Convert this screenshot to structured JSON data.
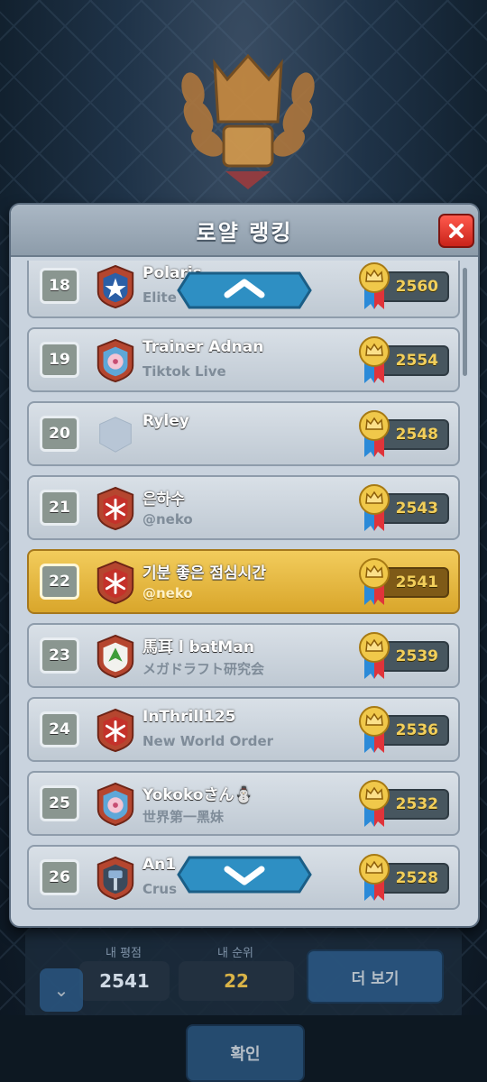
{
  "modal": {
    "title": "로얄 랭킹",
    "close_icon": "close-icon"
  },
  "rows": [
    {
      "rank": "18",
      "name": "Polaris",
      "clan": "Elite",
      "score": "2560",
      "badge": "star"
    },
    {
      "rank": "19",
      "name": "Trainer Adnan",
      "clan": "Tiktok Live",
      "score": "2554",
      "badge": "flower"
    },
    {
      "rank": "20",
      "name": "Ryley",
      "clan": "",
      "score": "2548",
      "badge": "none"
    },
    {
      "rank": "21",
      "name": "은하수",
      "clan": "@neko",
      "score": "2543",
      "badge": "snowflake"
    },
    {
      "rank": "22",
      "name": "기분 좋은 점심시간",
      "clan": "@neko",
      "score": "2541",
      "badge": "snowflake",
      "me": true
    },
    {
      "rank": "23",
      "name": "馬耳 l batMan",
      "clan": "メガドラフト研究会",
      "score": "2539",
      "badge": "leaf"
    },
    {
      "rank": "24",
      "name": "InThrill125",
      "clan": "New World Order",
      "score": "2536",
      "badge": "snowflake"
    },
    {
      "rank": "25",
      "name": "Yokokoさん⛄",
      "clan": "世界第一黑妹",
      "score": "2532",
      "badge": "flower"
    },
    {
      "rank": "26",
      "name": "An1",
      "clan": "Crus",
      "score": "2528",
      "badge": "hammer"
    }
  ],
  "footer": {
    "my_score_label": "내 평점",
    "my_score": "2541",
    "my_rank_label": "내 순위",
    "my_rank": "22",
    "more_button": "더 보기",
    "confirm_button": "확인"
  },
  "colors": {
    "highlight": "#e6b83f",
    "score_text": "#f2cf5b",
    "close": "#e0362c"
  }
}
